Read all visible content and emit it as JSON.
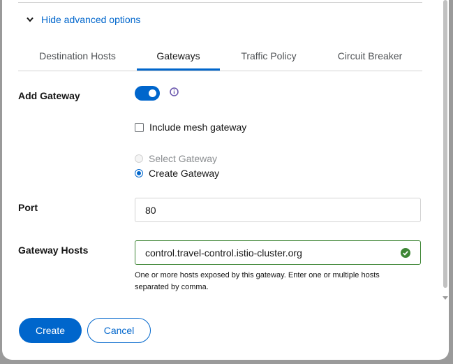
{
  "advanced": {
    "toggle_label": "Hide advanced options"
  },
  "tabs": [
    {
      "label": "Destination Hosts",
      "active": false
    },
    {
      "label": "Gateways",
      "active": true
    },
    {
      "label": "Traffic Policy",
      "active": false
    },
    {
      "label": "Circuit Breaker",
      "active": false
    }
  ],
  "add_gateway": {
    "label": "Add Gateway",
    "enabled": true
  },
  "mesh_gateway": {
    "label": "Include mesh gateway",
    "checked": false
  },
  "gateway_choice": {
    "select_label": "Select Gateway",
    "create_label": "Create Gateway",
    "selected": "create"
  },
  "port": {
    "label": "Port",
    "value": "80"
  },
  "gateway_hosts": {
    "label": "Gateway Hosts",
    "value": "control.travel-control.istio-cluster.org",
    "helper": "One or more hosts exposed by this gateway. Enter one or multiple hosts separated by comma."
  },
  "actions": {
    "create_label": "Create",
    "cancel_label": "Cancel"
  },
  "colors": {
    "accent": "#0066cc",
    "success": "#3e8635",
    "info": "#6753ac"
  }
}
